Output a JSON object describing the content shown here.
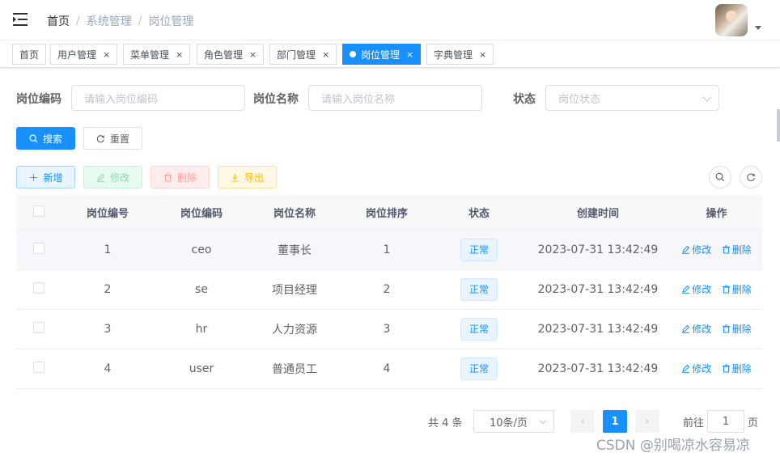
{
  "header": {
    "breadcrumb": [
      "首页",
      "系统管理",
      "岗位管理"
    ],
    "breadcrumb_sep": "/"
  },
  "tags": [
    {
      "label": "首页",
      "closable": false,
      "active": false
    },
    {
      "label": "用户管理",
      "closable": true,
      "active": false
    },
    {
      "label": "菜单管理",
      "closable": true,
      "active": false
    },
    {
      "label": "角色管理",
      "closable": true,
      "active": false
    },
    {
      "label": "部门管理",
      "closable": true,
      "active": false
    },
    {
      "label": "岗位管理",
      "closable": true,
      "active": true
    },
    {
      "label": "字典管理",
      "closable": true,
      "active": false
    }
  ],
  "tag_close": "×",
  "filters": {
    "code_label": "岗位编码",
    "code_placeholder": "请输入岗位编码",
    "name_label": "岗位名称",
    "name_placeholder": "请输入岗位名称",
    "status_label": "状态",
    "status_placeholder": "岗位状态"
  },
  "actions": {
    "search": "搜索",
    "reset": "重置",
    "add": "新增",
    "edit": "修改",
    "delete": "删除",
    "export": "导出"
  },
  "table": {
    "headers": [
      "岗位编号",
      "岗位编码",
      "岗位名称",
      "岗位排序",
      "状态",
      "创建时间",
      "操作"
    ],
    "rows": [
      {
        "id": "1",
        "code": "ceo",
        "name": "董事长",
        "sort": "1",
        "status": "正常",
        "created": "2023-07-31 13:42:49"
      },
      {
        "id": "2",
        "code": "se",
        "name": "项目经理",
        "sort": "2",
        "status": "正常",
        "created": "2023-07-31 13:42:49"
      },
      {
        "id": "3",
        "code": "hr",
        "name": "人力资源",
        "sort": "3",
        "status": "正常",
        "created": "2023-07-31 13:42:49"
      },
      {
        "id": "4",
        "code": "user",
        "name": "普通员工",
        "sort": "4",
        "status": "正常",
        "created": "2023-07-31 13:42:49"
      }
    ],
    "row_edit": "修改",
    "row_delete": "删除"
  },
  "pagination": {
    "total": "共 4 条",
    "page_size": "10条/页",
    "current": "1",
    "goto_label": "前往",
    "goto_value": "1",
    "goto_suffix": "页"
  },
  "watermark": "CSDN @别喝凉水容易凉",
  "colors": {
    "primary": "#1890ff",
    "success": "#13ce66",
    "danger": "#ff4949",
    "warning": "#ffba00"
  }
}
